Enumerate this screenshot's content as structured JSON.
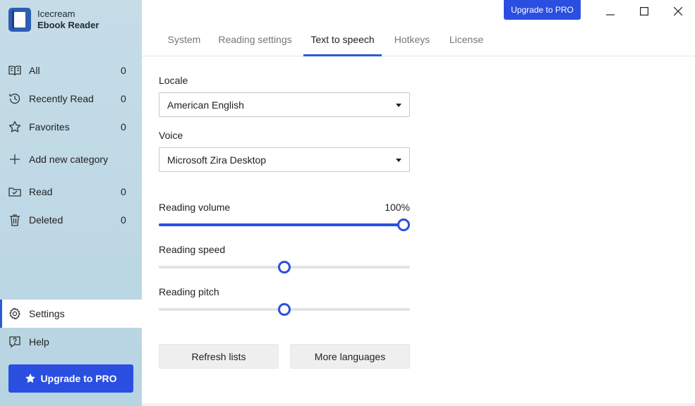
{
  "brand": {
    "line1": "Icecream",
    "line2": "Ebook Reader"
  },
  "sidebar": {
    "items": [
      {
        "label": "All",
        "count": "0"
      },
      {
        "label": "Recently Read",
        "count": "0"
      },
      {
        "label": "Favorites",
        "count": "0"
      },
      {
        "label": "Add new category"
      },
      {
        "label": "Read",
        "count": "0"
      },
      {
        "label": "Deleted",
        "count": "0"
      }
    ],
    "settings_label": "Settings",
    "help_label": "Help",
    "upgrade_label": "Upgrade to PRO"
  },
  "header": {
    "upgrade_label": "Upgrade to PRO"
  },
  "tabs": [
    {
      "label": "System"
    },
    {
      "label": "Reading settings"
    },
    {
      "label": "Text to speech"
    },
    {
      "label": "Hotkeys"
    },
    {
      "label": "License"
    }
  ],
  "tts": {
    "locale_label": "Locale",
    "locale_value": "American English",
    "voice_label": "Voice",
    "voice_value": "Microsoft Zira Desktop",
    "volume_label": "Reading volume",
    "volume_value": "100%",
    "volume_level": 1.0,
    "speed_label": "Reading speed",
    "speed_level": 0.5,
    "pitch_label": "Reading pitch",
    "pitch_level": 0.5,
    "refresh_label": "Refresh lists",
    "more_languages_label": "More languages"
  },
  "colors": {
    "accent": "#2a4fe0",
    "sidebar_bg": "#c6dde8"
  }
}
